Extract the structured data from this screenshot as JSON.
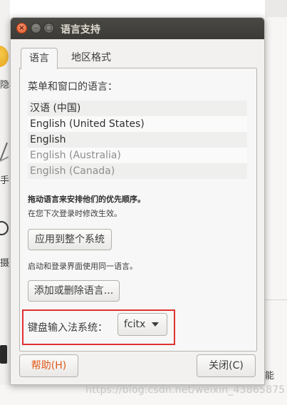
{
  "background": {
    "side_texts": [
      "隐私",
      "手",
      "摄"
    ],
    "right_text": "能"
  },
  "dialog": {
    "title": "语言支持",
    "tabs": [
      "语言",
      "地区格式"
    ],
    "menu_language_label": "菜单和窗口的语言：",
    "languages": [
      {
        "name": "汉语 (中国)",
        "active": true
      },
      {
        "name": "English (United States)",
        "active": true
      },
      {
        "name": "English",
        "active": true
      },
      {
        "name": "English (Australia)",
        "active": false
      },
      {
        "name": "English (Canada)",
        "active": false
      }
    ],
    "drag_hint": "拖动语言来安排他们的优先顺序。",
    "relogin_hint": "在您下次登录时修改生效。",
    "apply_button": "应用到整个系统",
    "login_hint": "启动和登录界面使用同一语言。",
    "add_remove_button": "添加或删除语言...",
    "keyboard_input_label": "键盘输入法系统：",
    "keyboard_input_value": "fcitx",
    "help_button": "帮助(H)",
    "close_button": "关闭(C)"
  },
  "watermark": "https://blog.csdn.net/weixin_43865875",
  "colors": {
    "titlebar": "#3b3a36",
    "close_button": "#e6541f",
    "highlight": "#e03131",
    "help_text": "#e05a1a"
  },
  "icons": [
    "close-icon",
    "minimize-icon",
    "maximize-icon",
    "chevron-down-icon"
  ]
}
